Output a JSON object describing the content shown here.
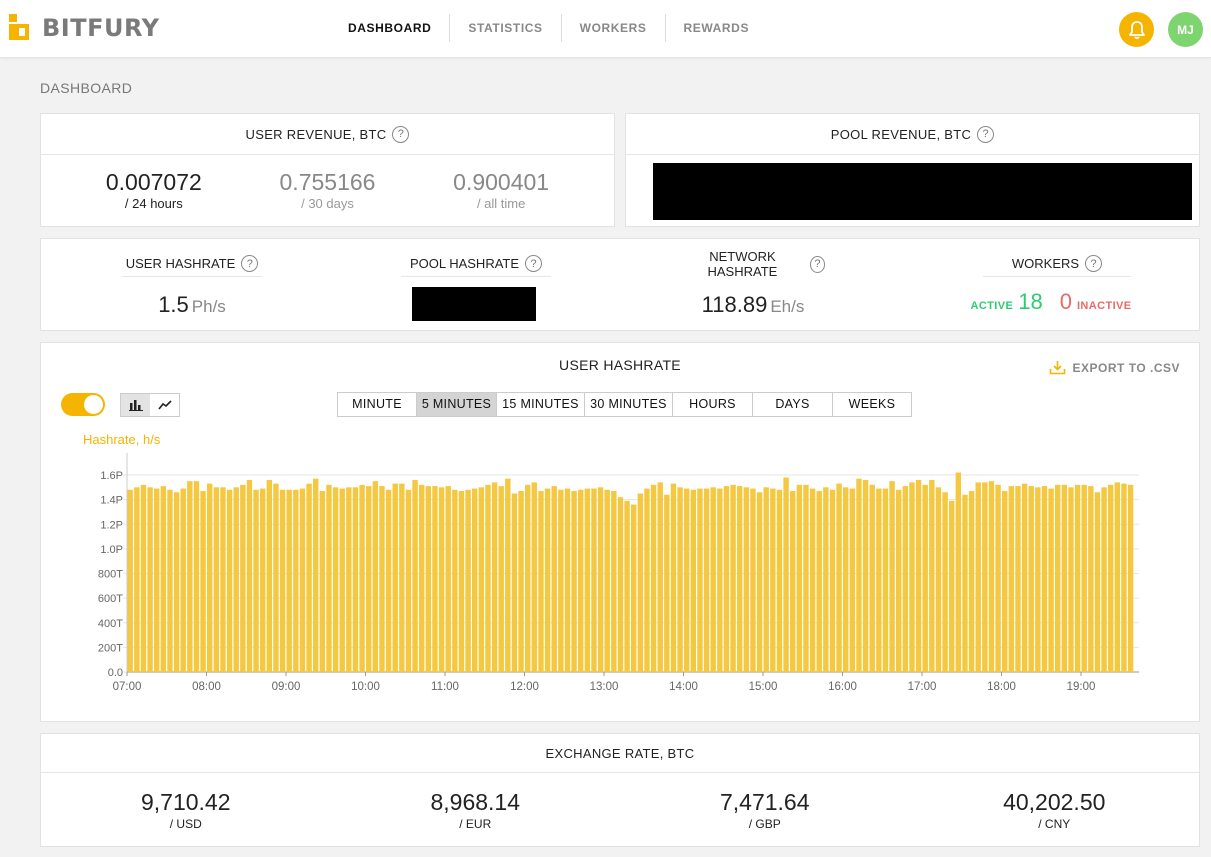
{
  "brand": {
    "name": "BITFURY"
  },
  "nav": [
    {
      "label": "DASHBOARD",
      "active": true
    },
    {
      "label": "STATISTICS",
      "active": false
    },
    {
      "label": "WORKERS",
      "active": false
    },
    {
      "label": "REWARDS",
      "active": false
    }
  ],
  "header": {
    "avatar_initials": "MJ",
    "bell_icon": "bell-icon"
  },
  "colors": {
    "accent": "#f4b400",
    "active_green": "#2ecc71",
    "inactive_red": "#e76a6a",
    "bar": "#f5c842"
  },
  "page_title": "DASHBOARD",
  "user_revenue": {
    "title": "USER REVENUE, BTC",
    "items": [
      {
        "value": "0.007072",
        "period": "/ 24 hours"
      },
      {
        "value": "0.755166",
        "period": "/ 30 days"
      },
      {
        "value": "0.900401",
        "period": "/ all time"
      }
    ]
  },
  "pool_revenue": {
    "title": "POOL REVENUE, BTC"
  },
  "hashrates": {
    "user": {
      "title": "USER HASHRATE",
      "value": "1.5",
      "unit": "Ph/s"
    },
    "pool": {
      "title": "POOL HASHRATE"
    },
    "network": {
      "title": "NETWORK HASHRATE",
      "value": "118.89",
      "unit": "Eh/s"
    },
    "workers": {
      "title": "WORKERS",
      "active_label": "ACTIVE",
      "active": "18",
      "inactive": "0",
      "inactive_label": "INACTIVE"
    }
  },
  "chart_section": {
    "title": "USER HASHRATE",
    "export_label": "EXPORT TO .CSV",
    "periods": [
      "MINUTE",
      "5 MINUTES",
      "15 MINUTES",
      "30 MINUTES",
      "HOURS",
      "DAYS",
      "WEEKS"
    ],
    "selected_period": "5 MINUTES",
    "toggle_on": true,
    "chart_type_selected": "bar"
  },
  "chart_data": {
    "type": "bar",
    "ylabel": "Hashrate, h/s",
    "ylim": [
      0,
      1.6
    ],
    "yticks": [
      "0.0",
      "200T",
      "400T",
      "600T",
      "800T",
      "1.0P",
      "1.2P",
      "1.4P",
      "1.6P"
    ],
    "ytick_values": [
      0,
      0.2,
      0.4,
      0.6,
      0.8,
      1.0,
      1.2,
      1.4,
      1.6
    ],
    "xticks": [
      "07:00",
      "08:00",
      "09:00",
      "10:00",
      "11:00",
      "12:00",
      "13:00",
      "14:00",
      "15:00",
      "16:00",
      "17:00",
      "18:00",
      "19:00"
    ],
    "x_start_label": "07:00",
    "interval_minutes": 5,
    "grid": true,
    "series": [
      {
        "values": [
          1.48,
          1.5,
          1.52,
          1.5,
          1.49,
          1.51,
          1.48,
          1.46,
          1.49,
          1.55,
          1.55,
          1.47,
          1.53,
          1.5,
          1.5,
          1.48,
          1.5,
          1.52,
          1.56,
          1.48,
          1.49,
          1.56,
          1.53,
          1.48,
          1.48,
          1.48,
          1.49,
          1.53,
          1.57,
          1.47,
          1.52,
          1.5,
          1.49,
          1.5,
          1.5,
          1.52,
          1.51,
          1.55,
          1.51,
          1.48,
          1.53,
          1.53,
          1.48,
          1.56,
          1.52,
          1.51,
          1.51,
          1.5,
          1.51,
          1.48,
          1.47,
          1.48,
          1.49,
          1.5,
          1.52,
          1.54,
          1.51,
          1.57,
          1.45,
          1.47,
          1.52,
          1.54,
          1.47,
          1.49,
          1.51,
          1.48,
          1.49,
          1.47,
          1.48,
          1.49,
          1.49,
          1.5,
          1.48,
          1.47,
          1.42,
          1.39,
          1.36,
          1.45,
          1.49,
          1.52,
          1.54,
          1.44,
          1.53,
          1.5,
          1.49,
          1.48,
          1.49,
          1.49,
          1.5,
          1.49,
          1.51,
          1.52,
          1.51,
          1.5,
          1.49,
          1.46,
          1.5,
          1.49,
          1.48,
          1.58,
          1.47,
          1.52,
          1.52,
          1.49,
          1.47,
          1.5,
          1.48,
          1.53,
          1.5,
          1.49,
          1.57,
          1.56,
          1.52,
          1.49,
          1.49,
          1.55,
          1.48,
          1.51,
          1.54,
          1.56,
          1.52,
          1.56,
          1.5,
          1.46,
          1.39,
          1.62,
          1.44,
          1.47,
          1.54,
          1.54,
          1.55,
          1.52,
          1.47,
          1.51,
          1.51,
          1.53,
          1.51,
          1.5,
          1.51,
          1.49,
          1.52,
          1.52,
          1.5,
          1.52,
          1.52,
          1.51,
          1.46,
          1.5,
          1.52,
          1.54,
          1.53,
          1.52
        ]
      }
    ]
  },
  "exchange": {
    "title": "EXCHANGE RATE, BTC",
    "items": [
      {
        "value": "9,710.42",
        "currency": "/ USD"
      },
      {
        "value": "8,968.14",
        "currency": "/ EUR"
      },
      {
        "value": "7,471.64",
        "currency": "/ GBP"
      },
      {
        "value": "40,202.50",
        "currency": "/ CNY"
      }
    ]
  }
}
